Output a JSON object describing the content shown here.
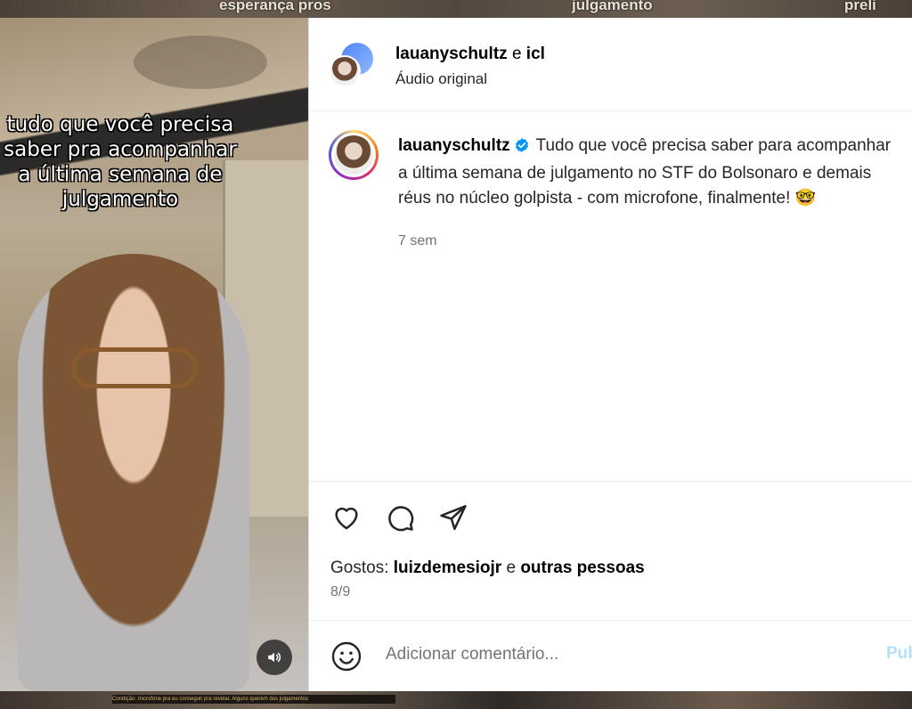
{
  "background": {
    "overlay_texts": [
      "esperança pros",
      "julgamento",
      "preli"
    ],
    "bottom_strip_text": "Condição: microfone pra eu conseguir pra revelar. Alguns querem dos julgamentos"
  },
  "video": {
    "caption": "tudo que você precisa saber pra acompanhar a última semana de julgamento",
    "sound_icon": "speaker-on-icon"
  },
  "header": {
    "user1": "lauanyschultz",
    "conjunction": "e",
    "user2": "icl",
    "audio": "Áudio original"
  },
  "post": {
    "username": "lauanyschultz",
    "line1": "Tudo que você precisa saber para acompanhar",
    "line2": "a última semana de julgamento no STF do Bolsonaro e demais",
    "line3": "réus no núcleo golpista - com microfone, finalmente! 🤓",
    "time": "7 sem"
  },
  "likes": {
    "prefix": "Gostos:",
    "user": "luizdemesiojr",
    "conjunction": "e",
    "others": "outras pessoas"
  },
  "counter": "8/9",
  "comment": {
    "placeholder": "Adicionar comentário...",
    "post_label": "Publicar"
  },
  "colors": {
    "verified": "#0095f6",
    "post_button": "#b2dffc",
    "muted_text": "#737373"
  }
}
